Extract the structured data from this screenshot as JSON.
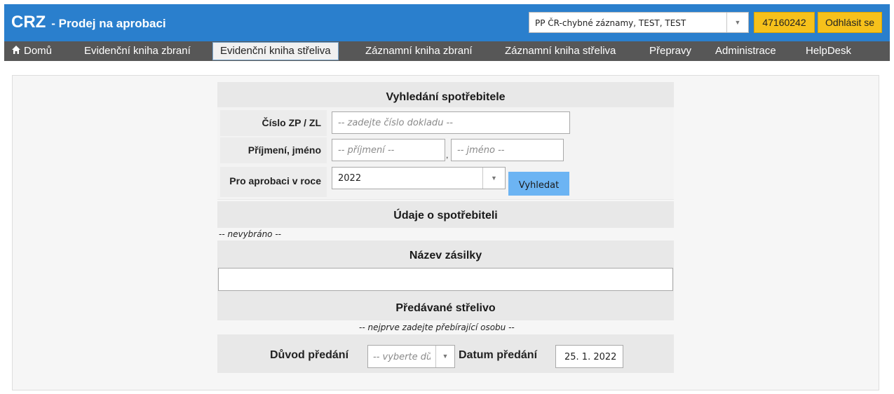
{
  "app": {
    "brand": "CRZ",
    "subtitle": "- Prodej na aprobaci",
    "user_selector": "PP ČR-chybné záznamy, TEST, TEST",
    "ico": "47160242",
    "logout_label": "Odhlásit se"
  },
  "nav": {
    "items": [
      {
        "label": "Domů",
        "icon": "home-icon"
      },
      {
        "label": "Evidenční kniha zbraní"
      },
      {
        "label": "Evidenční kniha střeliva",
        "active": true
      },
      {
        "label": "Záznamní kniha zbraní"
      },
      {
        "label": "Záznamní kniha střeliva"
      },
      {
        "label": "Přepravy"
      },
      {
        "label": "Administrace"
      },
      {
        "label": "HelpDesk"
      }
    ]
  },
  "search": {
    "title": "Vyhledání spotřebitele",
    "doc_label": "Číslo ZP / ZL",
    "doc_placeholder": "-- zadejte číslo dokladu --",
    "name_label": "Příjmení, jméno",
    "surname_placeholder": "-- příjmení --",
    "separator": ",",
    "firstname_placeholder": "-- jméno --",
    "year_label": "Pro aprobaci v roce",
    "year_value": "2022",
    "search_button": "Vyhledat"
  },
  "consumer": {
    "title": "Údaje o spotřebiteli",
    "status": "-- nevybráno --"
  },
  "shipment": {
    "title": "Název zásilky",
    "value": ""
  },
  "ammo": {
    "title": "Předávané střelivo",
    "note": "-- nejprve zadejte přebírající osobu --",
    "reason_label": "Důvod předání",
    "reason_placeholder": "-- vyberte dů",
    "date_label": "Datum předání",
    "date_value": "25. 1. 2022"
  },
  "colors": {
    "header_bg": "#2a7fcd",
    "nav_bg": "#575757",
    "accent_yellow": "#f6c11b",
    "search_button": "#6cb4f3"
  }
}
